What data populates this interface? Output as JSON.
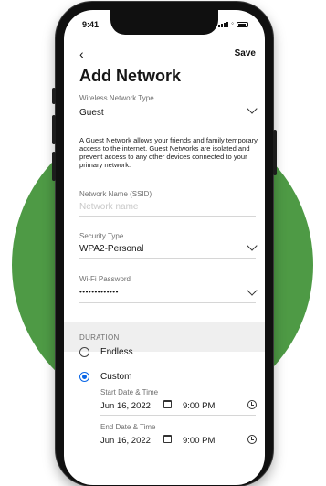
{
  "status": {
    "time": "9:41"
  },
  "header": {
    "back_label": "‹",
    "save_label": "Save",
    "title": "Add Network"
  },
  "network_type": {
    "label": "Wireless Network Type",
    "value": "Guest",
    "description": "A Guest Network allows your friends and family temporary access to the internet. Guest Networks are isolated and prevent access to any other devices connected to your primary network."
  },
  "ssid": {
    "label": "Network Name (SSID)",
    "placeholder": "Network name"
  },
  "security": {
    "label": "Security Type",
    "value": "WPA2-Personal"
  },
  "password": {
    "label": "Wi-Fi Password",
    "value": "•••••••••••••"
  },
  "duration": {
    "section_label": "DURATION",
    "options": [
      {
        "label": "Endless",
        "selected": false
      },
      {
        "label": "Custom",
        "selected": true
      }
    ],
    "start": {
      "label": "Start Date & Time",
      "date": "Jun 16, 2022",
      "time": "9:00 PM"
    },
    "end": {
      "label": "End Date & Time",
      "date": "Jun 16, 2022",
      "time": "9:00 PM"
    }
  },
  "colors": {
    "accent": "#0a66e6",
    "background_circle": "#4e9a45"
  },
  "icons": [
    "chevron-left-icon",
    "chevron-down-icon",
    "calendar-icon",
    "clock-icon",
    "signal-icon",
    "wifi-icon",
    "battery-icon"
  ]
}
